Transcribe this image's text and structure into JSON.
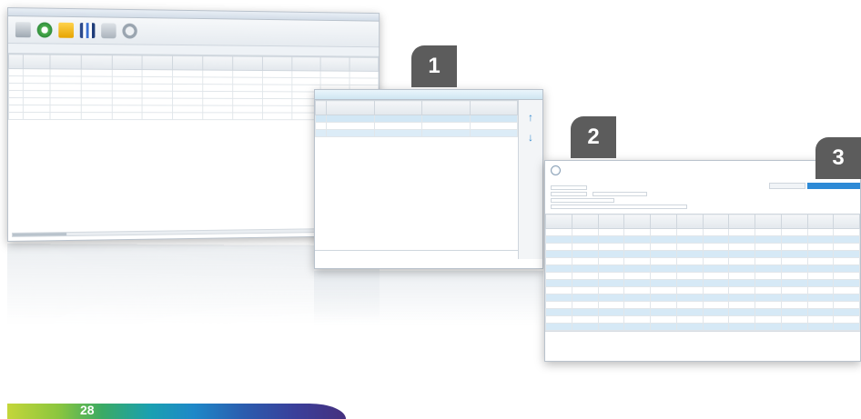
{
  "badges": [
    "1",
    "2",
    "3"
  ],
  "page_number": "28",
  "colors": {
    "badge": "#5c5c5c",
    "accent_blue": "#2d8ad6",
    "selection": "#d2e7f5",
    "band": [
      "#c4d63a",
      "#8cc63e",
      "#3aaa64",
      "#1aa0b0",
      "#1e88c8",
      "#2b5cae",
      "#3a3f9a",
      "#45307e"
    ]
  },
  "window1": {
    "icons": [
      "document-icon",
      "refresh-icon",
      "folder-icon",
      "chart-icon",
      "print-icon",
      "settings-icon"
    ]
  },
  "window2": {
    "side_icons": [
      "arrow-up-icon",
      "arrow-down-icon"
    ]
  },
  "window3": {
    "icons": [
      "window-icon"
    ]
  }
}
